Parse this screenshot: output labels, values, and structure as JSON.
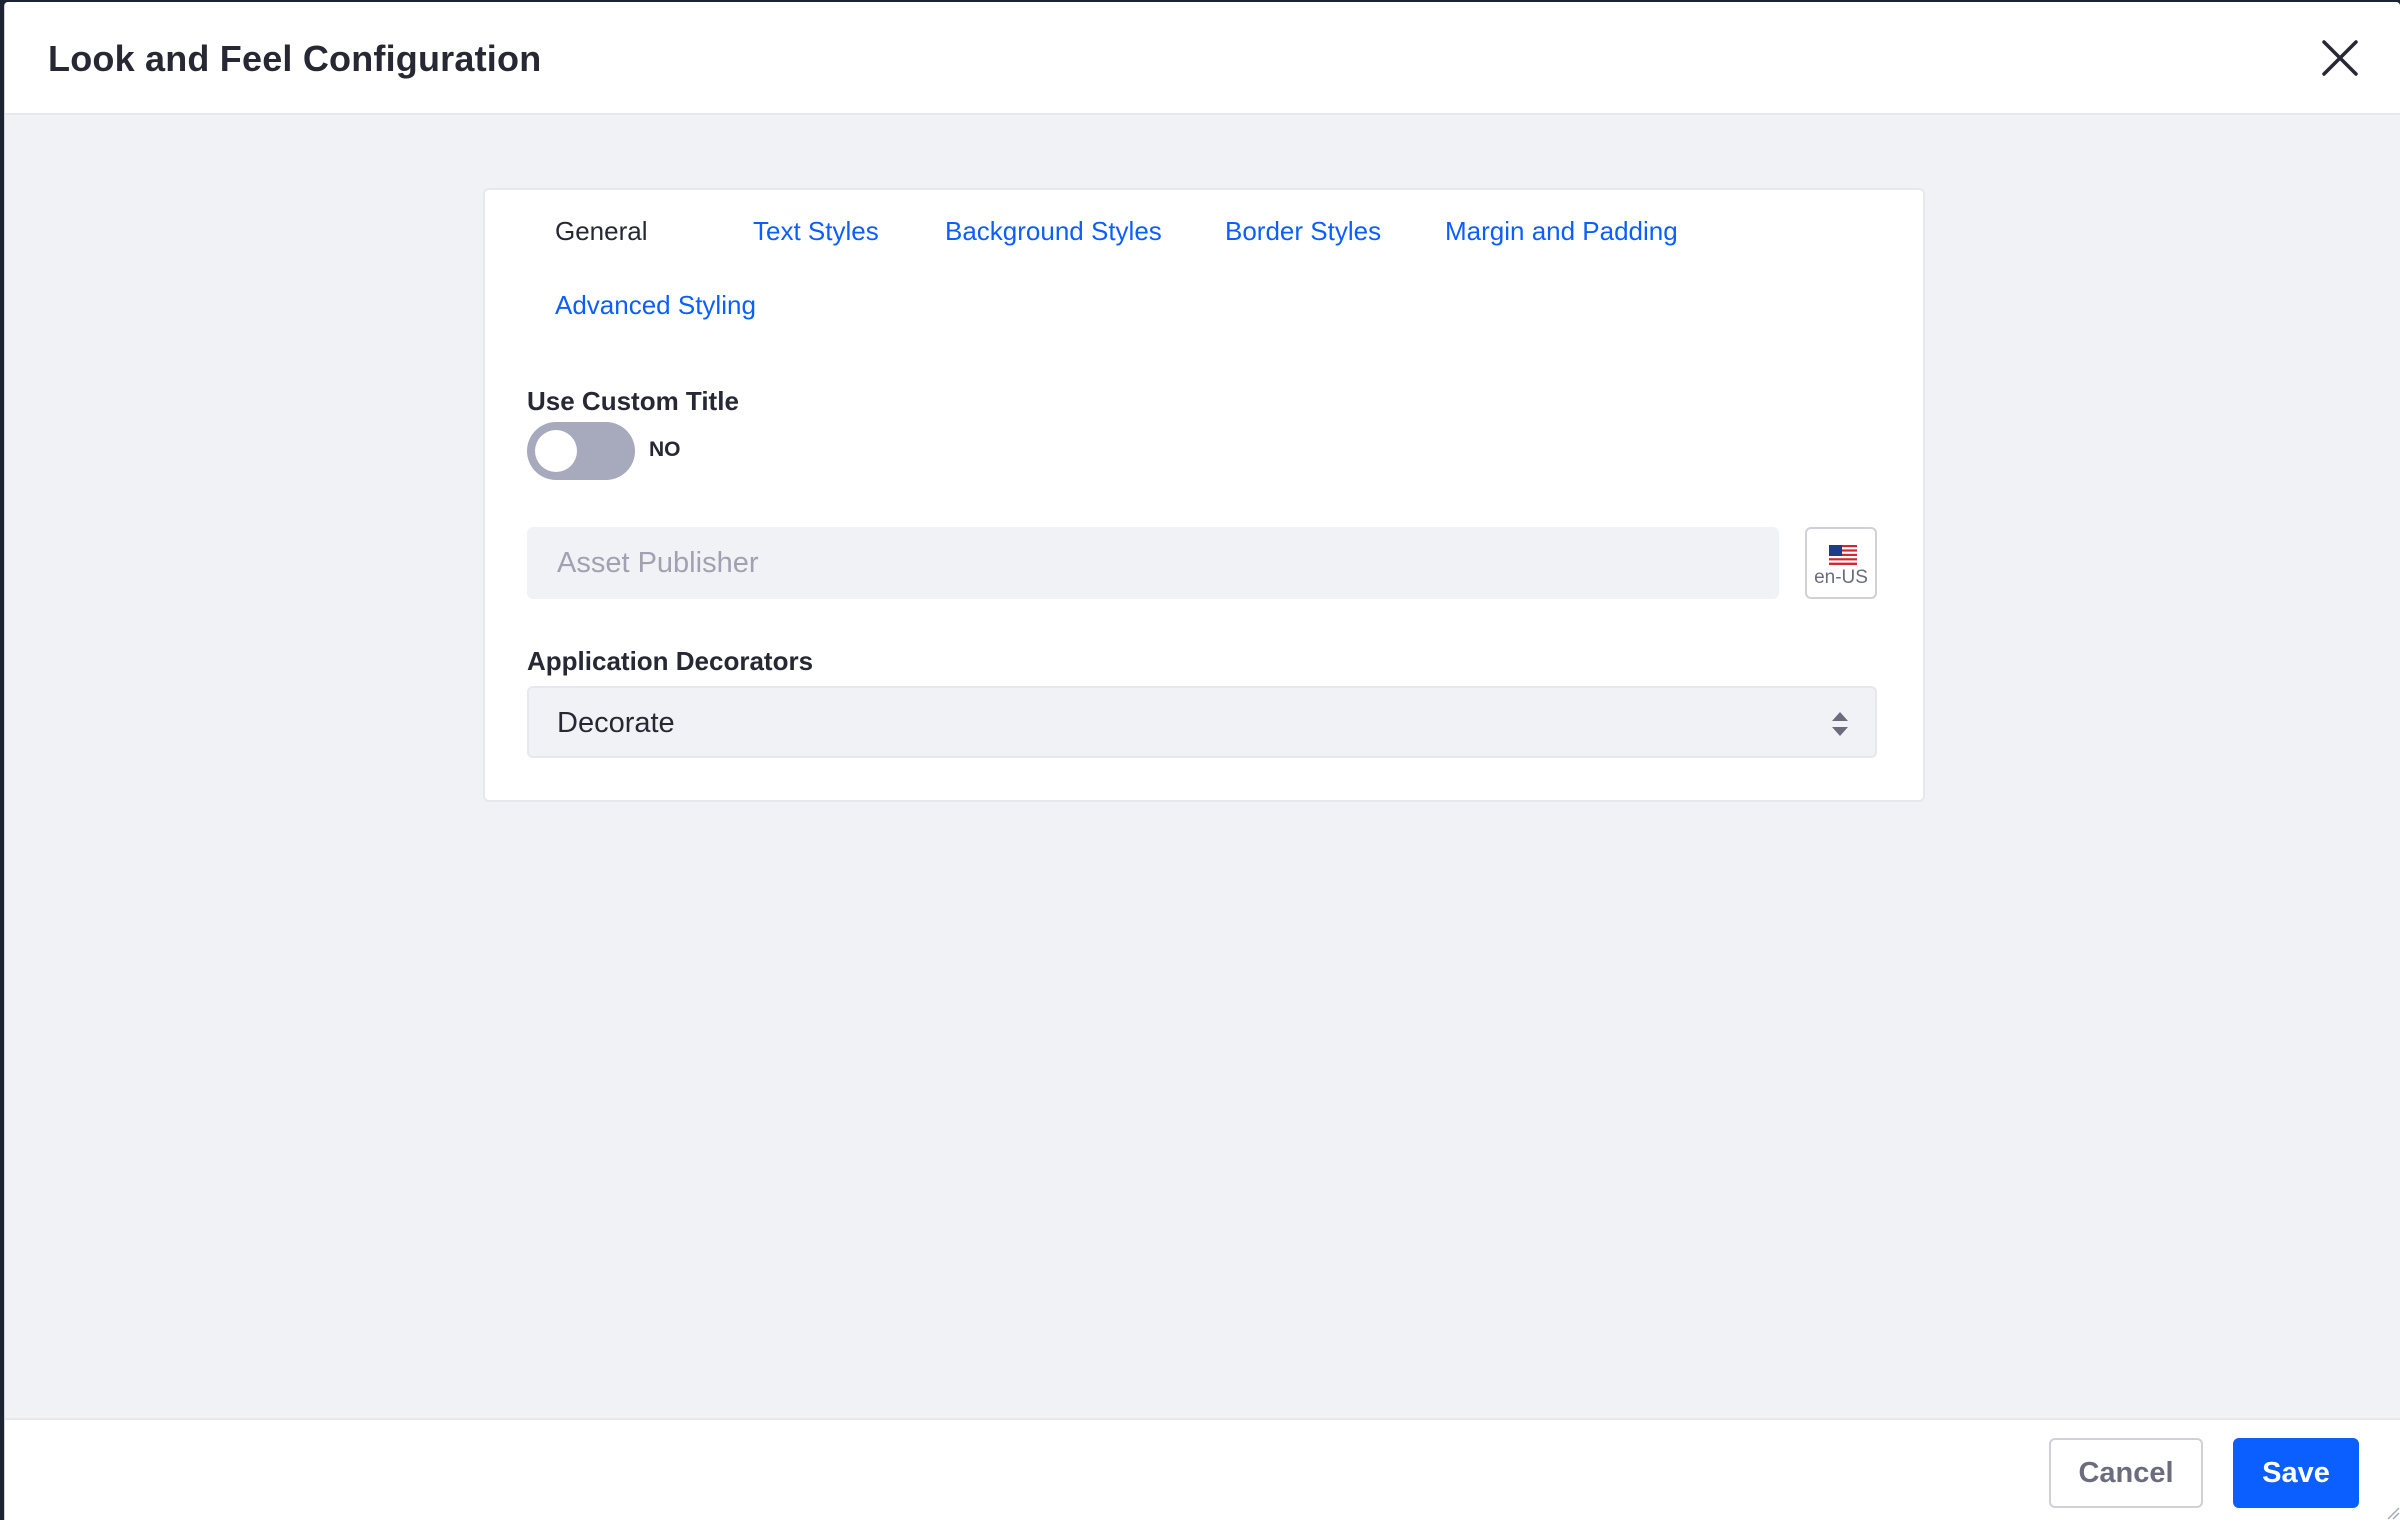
{
  "modal": {
    "title": "Look and Feel Configuration",
    "close_icon": "close-icon"
  },
  "tabs": [
    {
      "label": "General",
      "active": true
    },
    {
      "label": "Text Styles",
      "active": false
    },
    {
      "label": "Background Styles",
      "active": false
    },
    {
      "label": "Border Styles",
      "active": false
    },
    {
      "label": "Margin and Padding",
      "active": false
    },
    {
      "label": "Advanced Styling",
      "active": false
    }
  ],
  "custom_title": {
    "label": "Use Custom Title",
    "toggle_state": "NO",
    "input_placeholder": "Asset Publisher",
    "input_value": "",
    "language": "en-US",
    "flag_icon": "us-flag-icon"
  },
  "decorators": {
    "label": "Application Decorators",
    "selected": "Decorate"
  },
  "footer": {
    "cancel_label": "Cancel",
    "save_label": "Save"
  },
  "colors": {
    "accent": "#0b5fff",
    "text": "#272833",
    "toggle_off": "#a7a9bc",
    "body_bg": "#f1f2f5"
  }
}
